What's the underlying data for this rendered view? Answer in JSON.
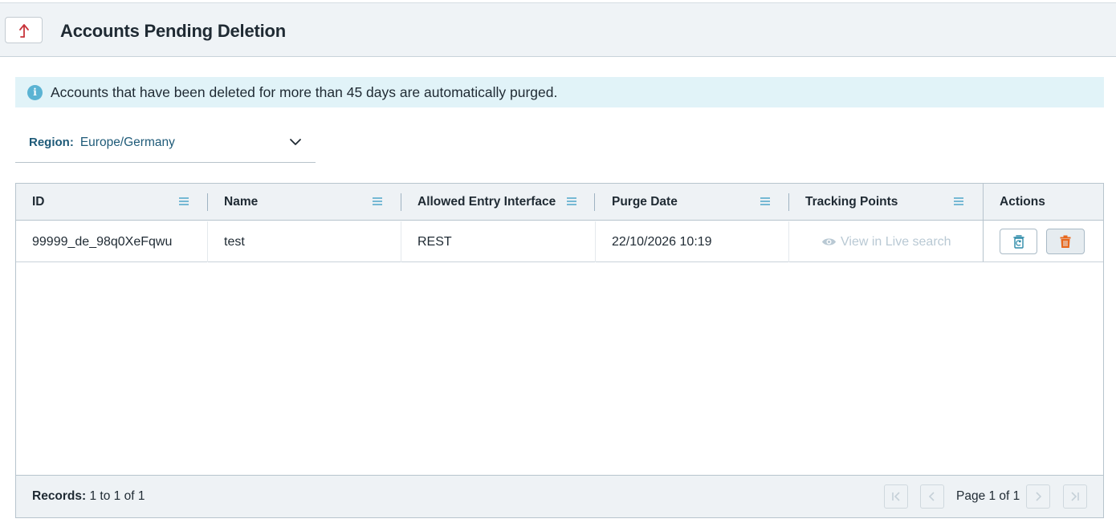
{
  "header": {
    "title": "Accounts Pending Deletion",
    "back_icon": "back-arrow-icon"
  },
  "info_banner": {
    "text": "Accounts that have been deleted for more than 45 days are automatically purged."
  },
  "region": {
    "label": "Region:",
    "value": "Europe/Germany"
  },
  "table": {
    "columns": [
      "ID",
      "Name",
      "Allowed Entry Interface",
      "Purge Date",
      "Tracking Points",
      "Actions"
    ],
    "rows": [
      {
        "id": "99999_de_98q0XeFqwu",
        "name": "test",
        "interface": "REST",
        "purge_date": "22/10/2026 10:19",
        "tracking": "View in Live search"
      }
    ]
  },
  "footer": {
    "records_label": "Records:",
    "records_value": "1 to 1 of 1",
    "page_text": "Page 1 of 1"
  },
  "colors": {
    "accent": "#1e5a78",
    "delete": "#e8671d",
    "restore": "#2c8aa8",
    "back_arrow": "#c8343b"
  }
}
